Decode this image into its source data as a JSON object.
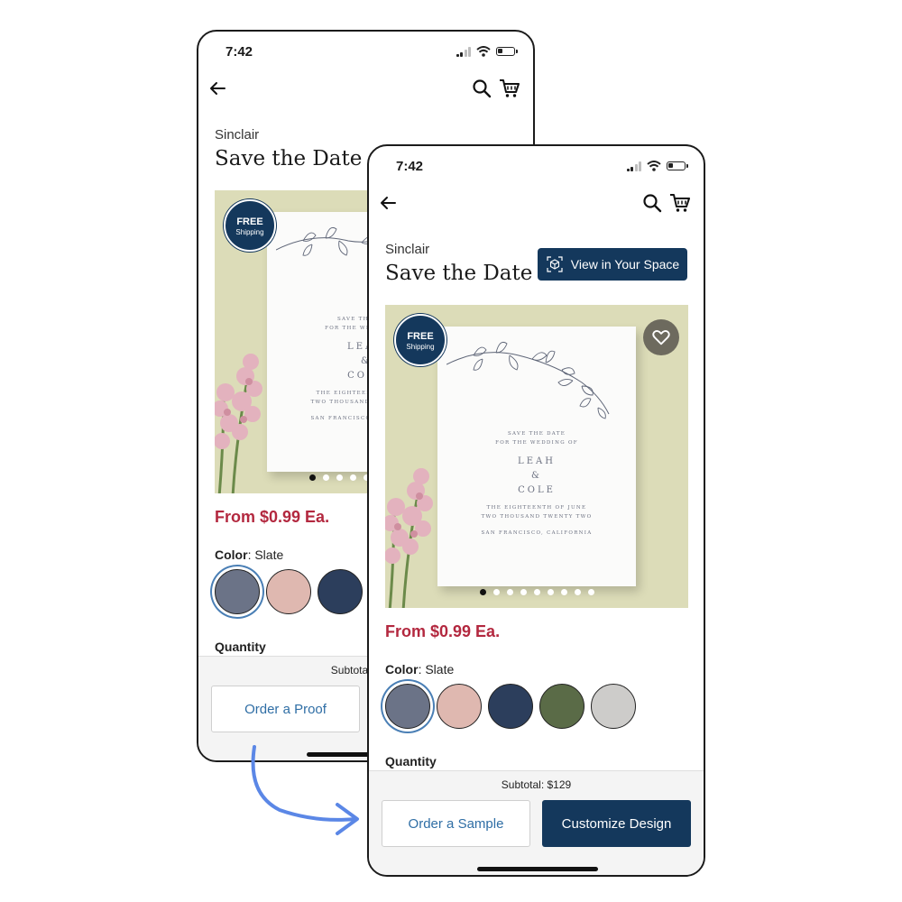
{
  "screens": {
    "back": {
      "status_time": "7:42",
      "brand": "Sinclair",
      "title": "Save the Date",
      "free_badge_line1": "FREE",
      "free_badge_line2": "Shipping",
      "price": "From $0.99 Ea.",
      "color_label": "Color",
      "color_value": ": Slate",
      "quantity_label": "Quantity",
      "subtotal": "Subtotal: $129",
      "primary_button": "Order a Proof",
      "carousel_dots": 9,
      "carousel_active_index": 0
    },
    "front": {
      "status_time": "7:42",
      "brand": "Sinclair",
      "title": "Save the Date",
      "view_in_space_label": "View in Your Space",
      "free_badge_line1": "FREE",
      "free_badge_line2": "Shipping",
      "price": "From $0.99 Ea.",
      "color_label": "Color",
      "color_value": ": Slate",
      "quantity_label": "Quantity",
      "subtotal": "Subtotal: $129",
      "secondary_button": "Order a Sample",
      "primary_button": "Customize Design",
      "carousel_dots": 9,
      "carousel_active_index": 0
    }
  },
  "invitation_card": {
    "line1": "SAVE THE DATE",
    "line2": "FOR THE WEDDING OF",
    "name1": "LEAH",
    "amp": "&",
    "name2": "COLE",
    "date1": "THE EIGHTEENTH OF JUNE",
    "date2": "TWO THOUSAND TWENTY TWO",
    "location": "SAN FRANCISCO, CALIFORNIA"
  },
  "swatch_colors": [
    "#6b7387",
    "#dfb8b0",
    "#2c3e5c",
    "#5a6b47",
    "#cdccca"
  ],
  "selected_swatch_index": 0,
  "colors": {
    "navy": "#14385c",
    "price_red": "#b3283f",
    "link_blue": "#2f6ea5",
    "arrow_blue": "#5b87e6"
  },
  "icons": [
    "back-arrow-icon",
    "search-icon",
    "cart-icon",
    "ar-cube-icon",
    "heart-icon",
    "flow-arrow"
  ]
}
